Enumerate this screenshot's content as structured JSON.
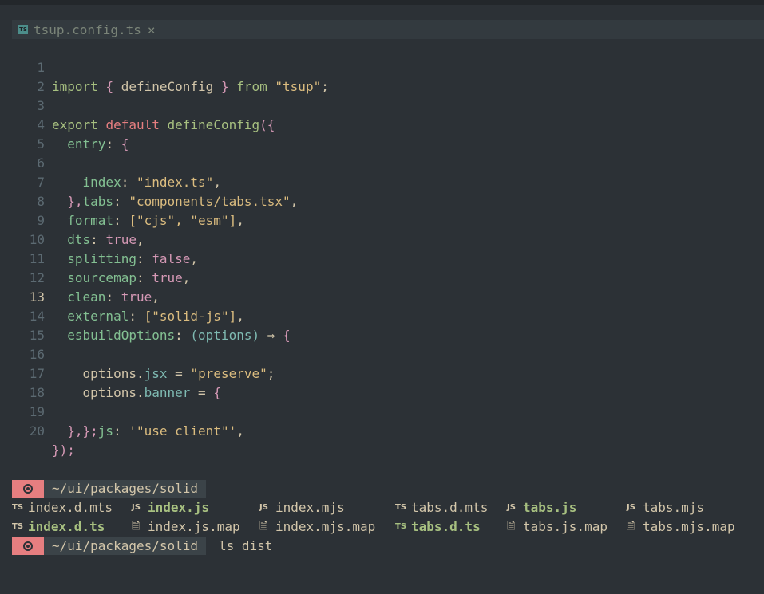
{
  "tab": {
    "title": "tsup.config.ts",
    "close": "×",
    "icon": "TS"
  },
  "editor": {
    "current_line": "13",
    "lines": [
      {
        "n": "1"
      },
      {
        "n": "2"
      },
      {
        "n": "3"
      },
      {
        "n": "4"
      },
      {
        "n": "5"
      },
      {
        "n": "6"
      },
      {
        "n": "7"
      },
      {
        "n": "8"
      },
      {
        "n": "9"
      },
      {
        "n": "10"
      },
      {
        "n": "11"
      },
      {
        "n": "12"
      },
      {
        "n": "13"
      },
      {
        "n": "14"
      },
      {
        "n": "15"
      },
      {
        "n": "16"
      },
      {
        "n": "17"
      },
      {
        "n": "18"
      },
      {
        "n": "19"
      },
      {
        "n": "20"
      }
    ],
    "tokens": {
      "import": "import",
      "lb": "{",
      "defineConfig": "defineConfig",
      "rb": "}",
      "from": "from",
      "tsup": "\"tsup\"",
      "semi": ";",
      "export": "export",
      "default": "default",
      "defineConfig2": "defineConfig",
      "open": "({",
      "entry": "entry",
      "colon": ":",
      "obrace": "{",
      "index": "index",
      "index_ts": "\"index.ts\"",
      "comma": ",",
      "tabs": "tabs",
      "tabs_tsx": "\"components/tabs.tsx\"",
      "close_obj": "},",
      "format": "format",
      "fmt_val": "[\"cjs\", \"esm\"]",
      "dts": "dts",
      "true": "true",
      "splitting": "splitting",
      "false": "false",
      "sourcemap": "sourcemap",
      "clean": "clean",
      "external": "external",
      "ext_val": "[\"solid-js\"]",
      "esbuildOptions": "esbuildOptions",
      "options_param": "(options)",
      "arrow": "⇒",
      "lbrace": "{",
      "options": "options",
      "dot": ".",
      "jsx": "jsx",
      "eq": "=",
      "preserve": "\"preserve\"",
      "banner": "banner",
      "js": "js",
      "use_client": "'\"use client\"'",
      "close_semi": "};",
      "close_all": "});"
    }
  },
  "terminal": {
    "prompt_path": "~/ui/packages/solid",
    "command": "ls dist",
    "files_row1": [
      {
        "icon": "TS",
        "name": "index.d.mts"
      },
      {
        "icon": "JS",
        "name": "index.js"
      },
      {
        "icon": "JS",
        "name": "index.mjs"
      },
      {
        "icon": "TS",
        "name": "tabs.d.mts"
      },
      {
        "icon": "JS",
        "name": "tabs.js"
      },
      {
        "icon": "JS",
        "name": "tabs.mjs"
      }
    ],
    "files_row2": [
      {
        "icon": "TS",
        "name": "index.d.ts"
      },
      {
        "icon": "doc",
        "name": "index.js.map"
      },
      {
        "icon": "doc",
        "name": "index.mjs.map"
      },
      {
        "icon": "TS",
        "name": "tabs.d.ts"
      },
      {
        "icon": "doc",
        "name": "tabs.js.map"
      },
      {
        "icon": "doc",
        "name": "tabs.mjs.map"
      }
    ]
  }
}
